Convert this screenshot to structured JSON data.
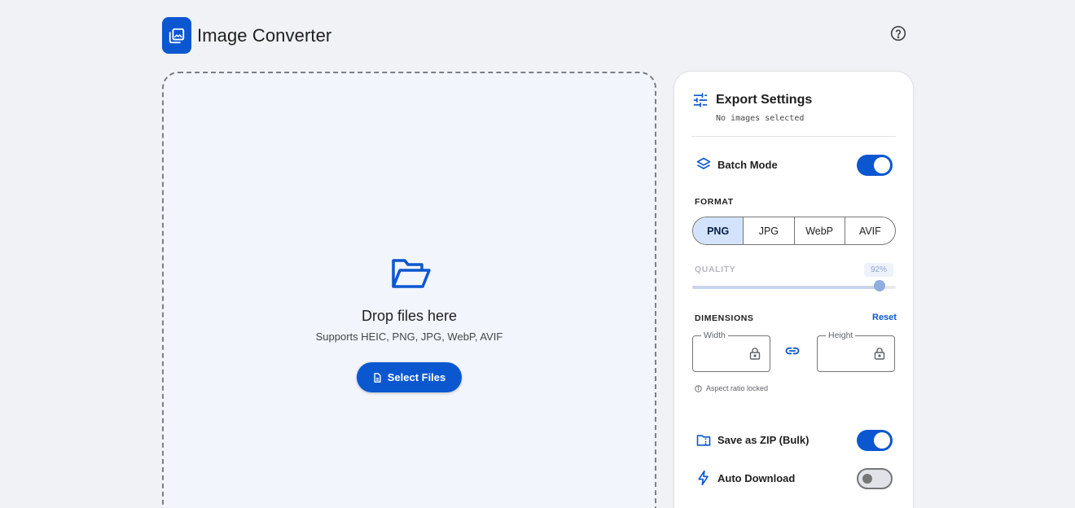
{
  "header": {
    "title": "Image Converter",
    "logo_icon": "photo-library-icon",
    "help_icon": "help-icon"
  },
  "dropzone": {
    "icon": "folder-open-icon",
    "title": "Drop files here",
    "subtitle": "Supports HEIC, PNG, JPG, WebP, AVIF",
    "button_label": "Select Files",
    "button_icon": "file-icon"
  },
  "settings": {
    "title": "Export Settings",
    "subtitle": "No images selected",
    "batch_mode": {
      "label": "Batch Mode",
      "enabled": true,
      "icon": "layers-icon"
    },
    "format": {
      "label": "FORMAT",
      "options": [
        "PNG",
        "JPG",
        "WebP",
        "AVIF"
      ],
      "selected": "PNG"
    },
    "quality": {
      "label": "QUALITY",
      "value_label": "92%",
      "value": 0.92,
      "disabled": true
    },
    "dimensions": {
      "label": "DIMENSIONS",
      "reset_label": "Reset",
      "width_label": "Width",
      "height_label": "Height",
      "width_value": "",
      "height_value": "",
      "aspect_note": "Aspect ratio locked"
    },
    "save_zip": {
      "label": "Save as ZIP (Bulk)",
      "enabled": true,
      "icon": "folder-zip-icon"
    },
    "auto_download": {
      "label": "Auto Download",
      "enabled": false,
      "icon": "bolt-icon"
    }
  },
  "colors": {
    "accent": "#0b57d0",
    "background": "#f0f2f5",
    "dropzone_bg": "#f2f5fc",
    "segment_active": "#d3e3fd"
  }
}
